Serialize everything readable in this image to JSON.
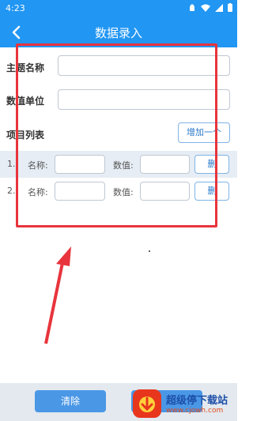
{
  "status_bar": {
    "time": "4:23"
  },
  "app_bar": {
    "title": "数据录入"
  },
  "form": {
    "subject_label": "主题名称",
    "subject_value": "",
    "unit_label": "数值单位",
    "unit_value": "",
    "list_label": "项目列表",
    "add_button": "增加一个"
  },
  "items": [
    {
      "index": "1.",
      "name_label": "名称:",
      "name_value": "",
      "value_label": "数值:",
      "value_value": "",
      "delete_label": "删"
    },
    {
      "index": "2.",
      "name_label": "名称:",
      "name_value": "",
      "value_label": "数值:",
      "value_value": "",
      "delete_label": "删"
    }
  ],
  "footer": {
    "clear_button": "清除"
  },
  "watermark": {
    "line1": "超级停下载站",
    "line2": "www.cjowh.com"
  },
  "colors": {
    "primary": "#2196f3",
    "annotation": "#e8343c",
    "button": "#4a97e6"
  }
}
